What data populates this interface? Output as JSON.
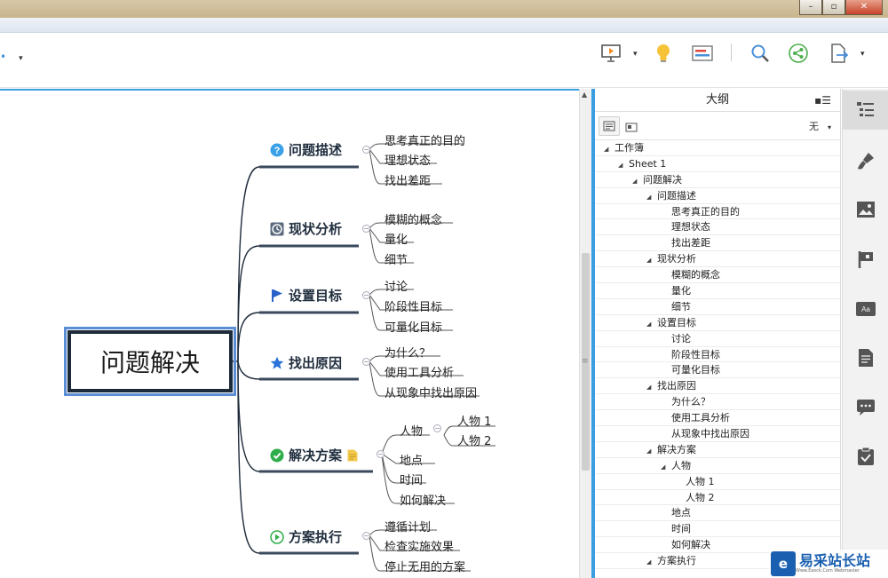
{
  "window": {
    "min_glyph": "–",
    "max_glyph": "▫",
    "close_glyph": "✕"
  },
  "toolbar": {
    "left_glyph": "•",
    "dropdown_glyph": "▾"
  },
  "mindmap": {
    "root": "问题解决",
    "topics": [
      {
        "label": "问题描述",
        "icon": "question-icon",
        "subs": [
          "思考真正的目的",
          "理想状态",
          "找出差距"
        ]
      },
      {
        "label": "现状分析",
        "icon": "clock-icon",
        "subs": [
          "模糊的概念",
          "量化",
          "细节"
        ]
      },
      {
        "label": "设置目标",
        "icon": "flag-icon",
        "subs": [
          "讨论",
          "阶段性目标",
          "可量化目标"
        ]
      },
      {
        "label": "找出原因",
        "icon": "star-icon",
        "subs": [
          "为什么？",
          "使用工具分析",
          "从现象中找出原因"
        ]
      },
      {
        "label": "解决方案",
        "icon": "check-icon",
        "subs": [
          "人物",
          "地点",
          "时间",
          "如何解决"
        ],
        "grandchildren": [
          "人物 1",
          "人物 2"
        ]
      },
      {
        "label": "方案执行",
        "icon": "play-icon",
        "subs": [
          "遵循计划",
          "检查实施效果",
          "停止无用的方案"
        ]
      }
    ]
  },
  "outline": {
    "title": "大纲",
    "menu_glyph": "▪☰",
    "filter": "无",
    "rows": [
      {
        "text": "工作簿",
        "level": 0,
        "expand": "◢"
      },
      {
        "text": "Sheet 1",
        "level": 1,
        "expand": "◢"
      },
      {
        "text": "问题解决",
        "level": 2,
        "expand": "◢"
      },
      {
        "text": "问题描述",
        "level": 3,
        "expand": "◢"
      },
      {
        "text": "思考真正的目的",
        "level": 4,
        "expand": ""
      },
      {
        "text": "理想状态",
        "level": 4,
        "expand": ""
      },
      {
        "text": "找出差距",
        "level": 4,
        "expand": ""
      },
      {
        "text": "现状分析",
        "level": 3,
        "expand": "◢"
      },
      {
        "text": "模糊的概念",
        "level": 4,
        "expand": ""
      },
      {
        "text": "量化",
        "level": 4,
        "expand": ""
      },
      {
        "text": "细节",
        "level": 4,
        "expand": ""
      },
      {
        "text": "设置目标",
        "level": 3,
        "expand": "◢"
      },
      {
        "text": "讨论",
        "level": 4,
        "expand": ""
      },
      {
        "text": "阶段性目标",
        "level": 4,
        "expand": ""
      },
      {
        "text": "可量化目标",
        "level": 4,
        "expand": ""
      },
      {
        "text": "找出原因",
        "level": 3,
        "expand": "◢"
      },
      {
        "text": "为什么？",
        "level": 4,
        "expand": ""
      },
      {
        "text": "使用工具分析",
        "level": 4,
        "expand": ""
      },
      {
        "text": "从现象中找出原因",
        "level": 4,
        "expand": ""
      },
      {
        "text": "解决方案",
        "level": 3,
        "expand": "◢"
      },
      {
        "text": "人物",
        "level": 4,
        "expand": "◢"
      },
      {
        "text": "人物 1",
        "level": 5,
        "expand": ""
      },
      {
        "text": "人物 2",
        "level": 5,
        "expand": ""
      },
      {
        "text": "地点",
        "level": 4,
        "expand": ""
      },
      {
        "text": "时间",
        "level": 4,
        "expand": ""
      },
      {
        "text": "如何解决",
        "level": 4,
        "expand": ""
      },
      {
        "text": "方案执行",
        "level": 3,
        "expand": "◢"
      }
    ]
  },
  "sidebar": {
    "items": [
      "outline-icon",
      "format-brush-icon",
      "image-icon",
      "marker-flag-icon",
      "text-style-icon",
      "notes-icon",
      "comment-icon",
      "task-icon"
    ]
  },
  "watermark": {
    "logo": "e",
    "text": "易采站长站",
    "sub": "Www.Easck.Com  Webmaster"
  },
  "colors": {
    "accent": "#3b9ee0",
    "branch_line": "#1d2a3a",
    "topic_underline": "#3a4a5c",
    "watermark": "#1a5fb0"
  }
}
